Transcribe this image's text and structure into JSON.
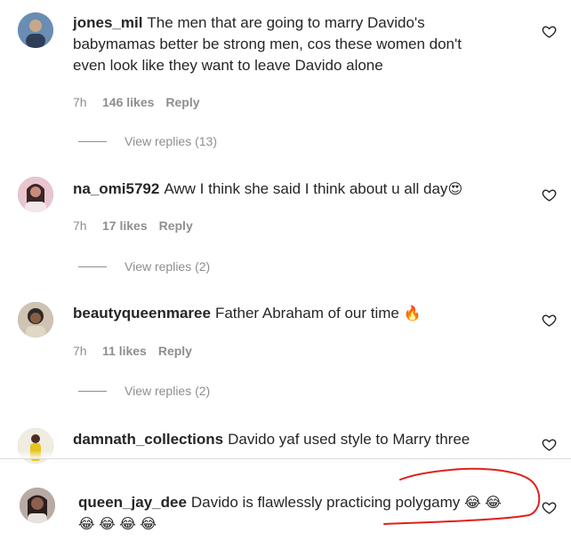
{
  "comments": [
    {
      "username": "jones_mil",
      "text_line1": "The men that are going to marry Davido's",
      "text_line2": "babymamas better be strong men, cos these women don't",
      "text_line3": "even look like they want to leave Davido alone",
      "time": "7h",
      "likes": "146 likes",
      "reply": "Reply",
      "view_replies": "View replies (13)"
    },
    {
      "username": "na_omi5792",
      "text": "Aww I think she said I think about u all day",
      "emoji": "😍",
      "time": "7h",
      "likes": "17 likes",
      "reply": "Reply",
      "view_replies": "View replies (2)"
    },
    {
      "username": "beautyqueenmaree",
      "text": "Father Abraham of our time",
      "emoji": "🔥",
      "time": "7h",
      "likes": "11 likes",
      "reply": "Reply",
      "view_replies": "View replies (2)"
    },
    {
      "username": "damnath_collections",
      "text": "Davido yaf used style to Marry three"
    }
  ],
  "composer": {
    "username": "queen_jay_dee",
    "text": "Davido is flawlessly practicing polygamy",
    "emoji_line1": "😂 😂",
    "emoji_line2": "😂 😂 😂 😂"
  },
  "icons": {
    "like": "heart-icon"
  },
  "colors": {
    "annotation": "#e0201c",
    "meta_text": "#8e8e8e",
    "body_text": "#262626"
  }
}
